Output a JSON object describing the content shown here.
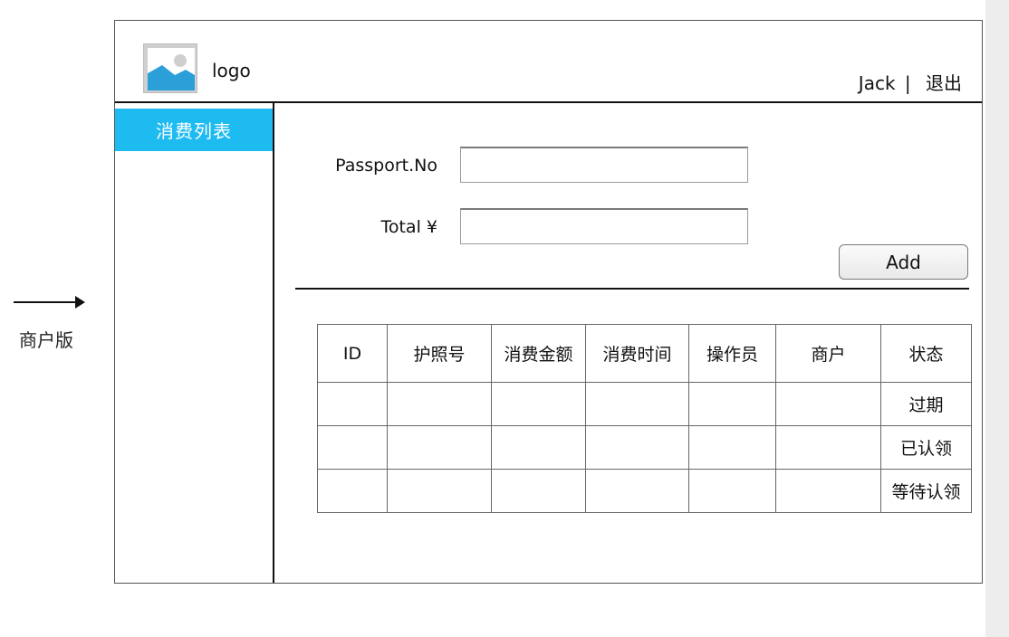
{
  "annotation": {
    "label": "商户版"
  },
  "header": {
    "logo_text": "logo",
    "user_name": "Jack",
    "separator": "|",
    "logout_label": "退出"
  },
  "sidebar": {
    "items": [
      {
        "label": "消费列表",
        "active": true
      }
    ]
  },
  "form": {
    "passport_label": "Passport.No",
    "passport_value": "",
    "total_label": "Total ¥",
    "total_value": "",
    "add_label": "Add"
  },
  "table": {
    "columns": [
      "ID",
      "护照号",
      "消费金额",
      "消费时间",
      "操作员",
      "商户",
      "状态"
    ],
    "rows": [
      [
        "",
        "",
        "",
        "",
        "",
        "",
        "过期"
      ],
      [
        "",
        "",
        "",
        "",
        "",
        "",
        "已认领"
      ],
      [
        "",
        "",
        "",
        "",
        "",
        "",
        "等待认领"
      ]
    ]
  },
  "colors": {
    "accent": "#1ebbf1",
    "border": "#666666"
  },
  "icons": {
    "logo": "image-placeholder-icon",
    "arrow": "arrow-right-icon"
  }
}
